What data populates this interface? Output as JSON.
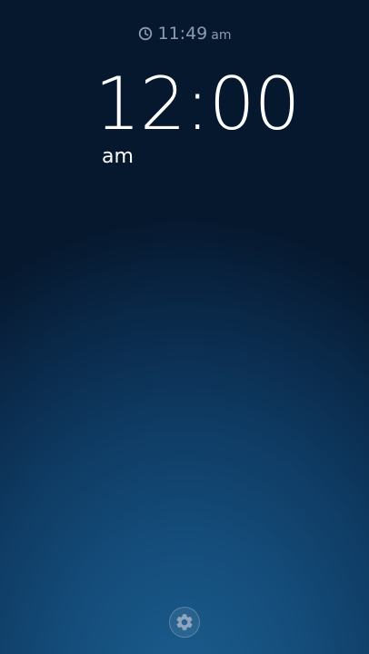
{
  "status_bar": {
    "icon": "clock-icon",
    "current_time": "11:49",
    "ampm": "am"
  },
  "alarm": {
    "time": "12:00",
    "ampm": "am"
  },
  "settings": {
    "icon": "gear-icon"
  },
  "colors": {
    "background_top": "#06182e",
    "background_bottom": "#1b5d8e",
    "text_primary": "#ffffff",
    "text_secondary": "#8c9bb0"
  }
}
